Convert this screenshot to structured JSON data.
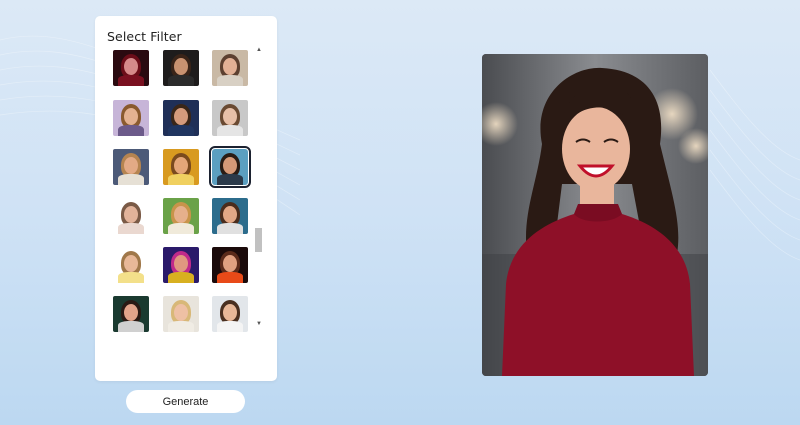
{
  "panel": {
    "title": "Select Filter",
    "filters": [
      {
        "name": "filter-1",
        "bg": "#2a0a10",
        "skin": "#d68a8a",
        "hair": "#6b0d18",
        "cloth": "#7a1020"
      },
      {
        "name": "filter-2",
        "bg": "#1e1c1c",
        "skin": "#c99270",
        "hair": "#3a2418",
        "cloth": "#2b2b2b"
      },
      {
        "name": "filter-3",
        "bg": "#c9b9a5",
        "skin": "#e2b196",
        "hair": "#5c4030",
        "cloth": "#d8d0c4"
      },
      {
        "name": "filter-4",
        "bg": "#c7b5d8",
        "skin": "#e4b291",
        "hair": "#8a5a2e",
        "cloth": "#6c5a8a"
      },
      {
        "name": "filter-5",
        "bg": "#1f2f57",
        "skin": "#d59b7c",
        "hair": "#3a2618",
        "cloth": "#203560"
      },
      {
        "name": "filter-6",
        "bg": "#c8c8c8",
        "skin": "#e8c0a8",
        "hair": "#6a4a32",
        "cloth": "#e5e5e5"
      },
      {
        "name": "filter-7",
        "bg": "#4c5a78",
        "skin": "#e3aa86",
        "hair": "#b58450",
        "cloth": "#e6e0d5"
      },
      {
        "name": "filter-8",
        "bg": "#d89a20",
        "skin": "#e4a679",
        "hair": "#7a4a1e",
        "cloth": "#f0d060"
      },
      {
        "name": "filter-9",
        "bg": "#5b9fc0",
        "skin": "#d59a78",
        "hair": "#2a1c14",
        "cloth": "#2b3a4a"
      },
      {
        "name": "filter-10",
        "bg": "#ffffff",
        "skin": "#e2b39a",
        "hair": "#7a5a46",
        "cloth": "#ead8d0"
      },
      {
        "name": "filter-11",
        "bg": "#6aa248",
        "skin": "#e6b08c",
        "hair": "#c8944a",
        "cloth": "#f0eada"
      },
      {
        "name": "filter-12",
        "bg": "#2c6c8c",
        "skin": "#e2a886",
        "hair": "#4a2c1c",
        "cloth": "#e0e0e0"
      },
      {
        "name": "filter-13",
        "bg": "#ffffff",
        "skin": "#e8b898",
        "hair": "#a0784a",
        "cloth": "#f3e08a"
      },
      {
        "name": "filter-14",
        "bg": "#2a1a6a",
        "skin": "#e09880",
        "hair": "#c02a8a",
        "cloth": "#d8b020"
      },
      {
        "name": "filter-15",
        "bg": "#1a0a0a",
        "skin": "#e0a080",
        "hair": "#5a2a1a",
        "cloth": "#e84a18"
      },
      {
        "name": "filter-16",
        "bg": "#1a3a30",
        "skin": "#e2a48a",
        "hair": "#2a1a14",
        "cloth": "#d0d0d0"
      },
      {
        "name": "filter-17",
        "bg": "#e8e4dc",
        "skin": "#eec0a4",
        "hair": "#d8b878",
        "cloth": "#f0ece4"
      },
      {
        "name": "filter-18",
        "bg": "#e2e6ea",
        "skin": "#e8b898",
        "hair": "#4a3020",
        "cloth": "#f4f4f4"
      }
    ],
    "selected_index": 8,
    "scroll_up_icon": "triangle-up-icon",
    "scroll_down_icon": "triangle-down-icon",
    "scroll_position_fraction": 0.72
  },
  "actions": {
    "generate_label": "Generate"
  },
  "preview": {
    "image": "photo-of-smiling-woman-in-red-sweater",
    "colors": {
      "sweater": "#8e1028",
      "hair": "#2a1a14",
      "skin": "#e9b69c",
      "background": "#6b6e72"
    }
  }
}
